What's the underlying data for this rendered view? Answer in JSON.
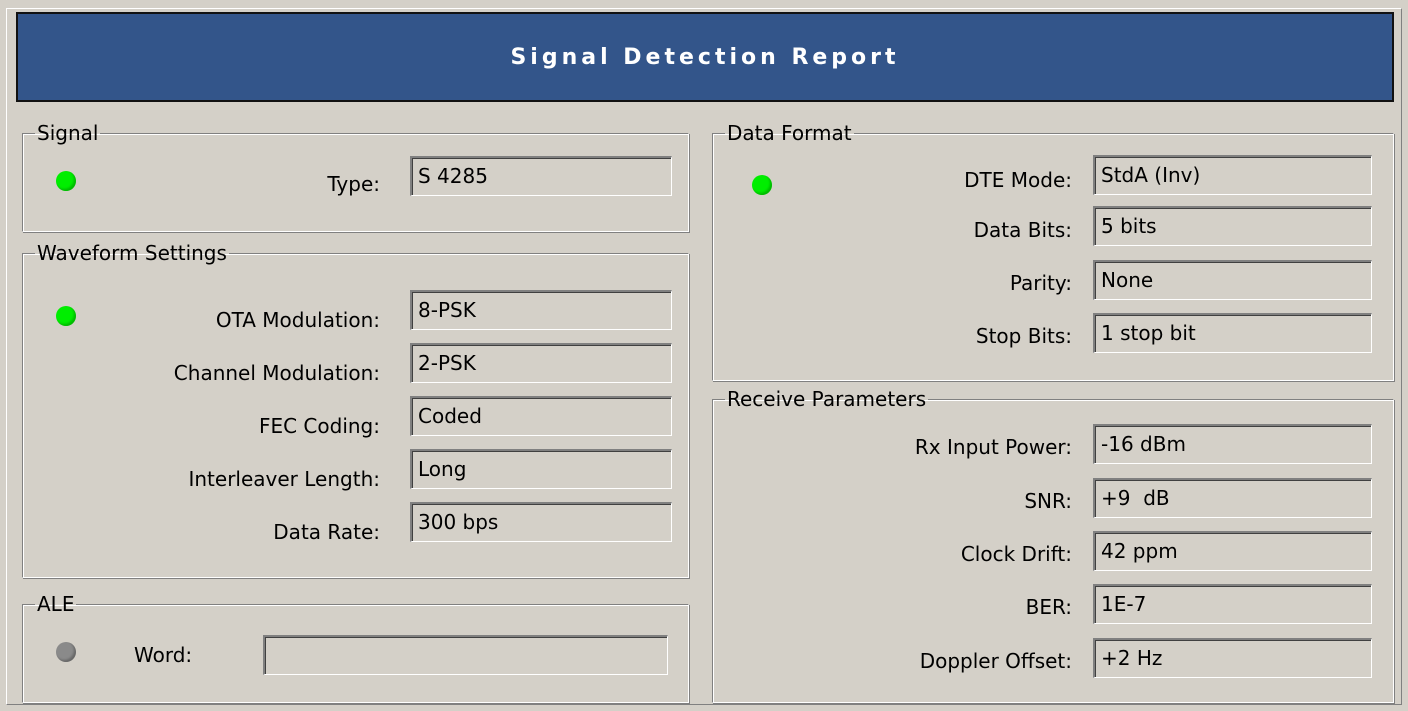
{
  "title": "Signal Detection Report",
  "signal": {
    "legend": "Signal",
    "indicator": "on",
    "type_label": "Type:",
    "type_value": "S 4285"
  },
  "waveform": {
    "legend": "Waveform Settings",
    "indicator": "on",
    "rows": [
      {
        "label": "OTA Modulation:",
        "value": "8-PSK"
      },
      {
        "label": "Channel Modulation:",
        "value": "2-PSK"
      },
      {
        "label": "FEC Coding:",
        "value": "Coded"
      },
      {
        "label": "Interleaver Length:",
        "value": "Long"
      },
      {
        "label": "Data Rate:",
        "value": "300 bps"
      }
    ]
  },
  "ale": {
    "legend": "ALE",
    "indicator": "off",
    "word_label": "Word:",
    "word_value": ""
  },
  "data_format": {
    "legend": "Data Format",
    "indicator": "on",
    "rows": [
      {
        "label": "DTE Mode:",
        "value": "StdA (Inv)"
      },
      {
        "label": "Data Bits:",
        "value": "5 bits"
      },
      {
        "label": "Parity:",
        "value": "None"
      },
      {
        "label": "Stop Bits:",
        "value": "1 stop bit"
      }
    ]
  },
  "receive": {
    "legend": "Receive Parameters",
    "rows": [
      {
        "label": "Rx Input Power:",
        "value": "-16 dBm"
      },
      {
        "label": "SNR:",
        "value": "+9  dB"
      },
      {
        "label": "Clock Drift:",
        "value": "42 ppm"
      },
      {
        "label": "BER:",
        "value": "1E-7"
      },
      {
        "label": "Doppler Offset:",
        "value": "+2 Hz"
      }
    ]
  },
  "colors": {
    "title_bg": "#33558a",
    "led_on": "#00ee00",
    "led_off": "#8a8a8a",
    "panel_bg": "#d4d0c8"
  }
}
